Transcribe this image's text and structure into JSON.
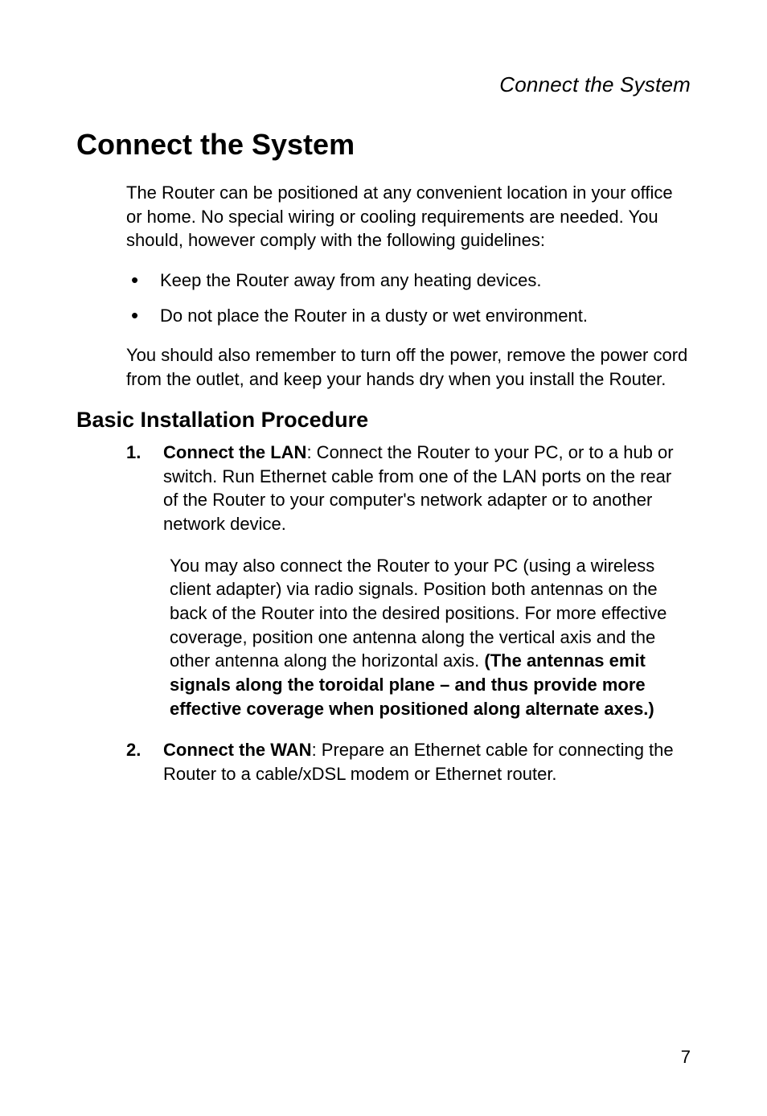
{
  "running_head": "Connect the System",
  "h1": "Connect the System",
  "intro": "The Router can be positioned at any convenient location in your office or home. No special wiring or cooling requirements are needed. You should, however comply with the following guidelines:",
  "bullets": [
    "Keep the Router away from any heating devices.",
    "Do not place the Router in a dusty or wet environment."
  ],
  "after_bullets": "You should also remember to turn off the power, remove the power cord from the outlet, and keep your hands dry when you install the Router.",
  "h2": "Basic Installation Procedure",
  "steps": [
    {
      "marker": "1.",
      "lead": "Connect the LAN",
      "body": ": Connect the Router to your PC, or to a hub or switch. Run Ethernet cable from one of the LAN ports on the rear of the Router to your computer's network adapter or to another network device.",
      "sub_plain": "You may also connect the Router to your PC (using a wireless client adapter) via radio signals. Position both antennas on the back of the Router into the desired positions. For more effective coverage, position one antenna along the vertical axis and the other antenna along the horizontal axis. ",
      "sub_bold": "(The antennas emit signals along the toroidal plane – and thus provide more effective coverage when positioned along alternate axes.)"
    },
    {
      "marker": "2.",
      "lead": "Connect the WAN",
      "body": ": Prepare an Ethernet cable for connecting the Router to a cable/xDSL modem or Ethernet router."
    }
  ],
  "page_number": "7"
}
